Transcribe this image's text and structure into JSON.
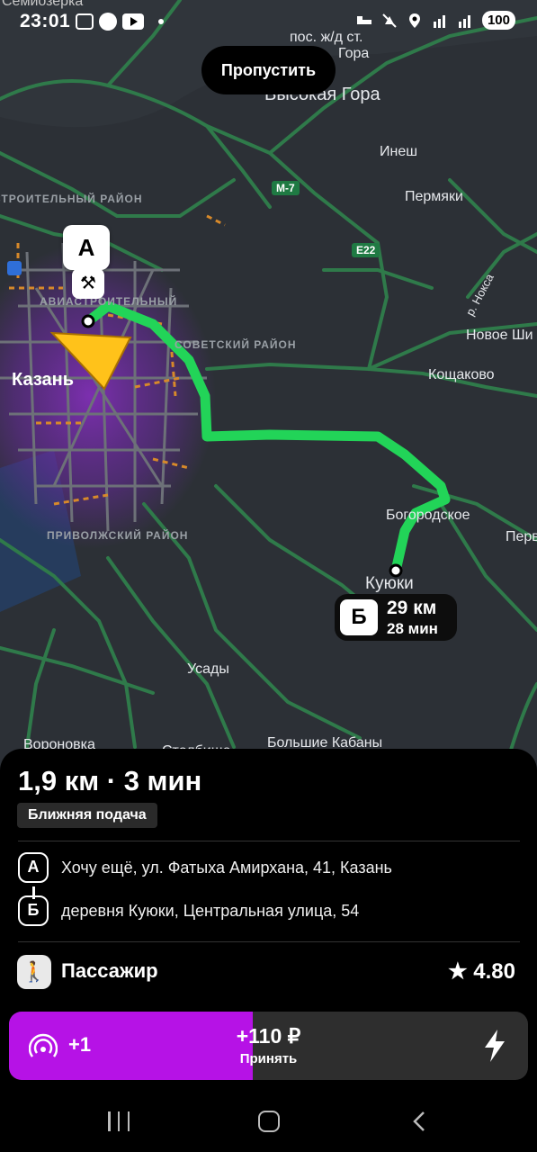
{
  "status_bar": {
    "time": "23:01",
    "battery": "100"
  },
  "map": {
    "skip_button": "Пропустить",
    "labels": {
      "semiozerka": "Семиозерка",
      "pos_zhd_st": "пос. ж/д ст.",
      "gora": "Гора",
      "vysokaya_gora": "Высокая Гора",
      "inesh": "Инеш",
      "permyaki": "Пермяки",
      "kazan": "Казань",
      "novoe_shi": "Новое Ши",
      "koshchakovo": "Кощаково",
      "bogorodskoe": "Богородское",
      "perv": "Перв",
      "kuyuki": "Куюки",
      "usady": "Усады",
      "voronovka": "Вороновка",
      "stolbishche": "Столбище",
      "bolshie_kabany": "Большие Кабаны",
      "r_noksa": "р. Нокса",
      "district_stroitelny": "СТРОИТЕЛЬНЫЙ РАЙОН",
      "district_aviastroitelny": "АВИАСТРОИТЕЛЬНЫЙ",
      "district_sovetsky": "СОВЕТСКИЙ РАЙОН",
      "district_privolzhsky": "ПРИВОЛЖСКИЙ РАЙОН"
    },
    "road_badges": {
      "m7": "М-7",
      "e22": "E22"
    },
    "marker_a": "А",
    "destination": {
      "letter": "Б",
      "distance": "29 км",
      "duration": "28 мин"
    },
    "colors": {
      "route": "#22d458",
      "roads": "#2f7a4a",
      "background": "#2c3036",
      "heat": "#8a2fc4"
    }
  },
  "order": {
    "eta": "1,9 км · 3 мин",
    "badge": "Ближняя подача",
    "pickup": {
      "letter": "А",
      "address": "Хочу ещё, ул. Фатыха Амирхана, 41, Казань"
    },
    "dropoff": {
      "letter": "Б",
      "address": "деревня Куюки, Центральная улица, 54"
    },
    "passenger": {
      "label": "Пассажир",
      "rating": "★ 4.80",
      "icon": "person-walking-icon"
    },
    "accept": {
      "multiplier": "+1",
      "price": "+110 ₽",
      "label": "Принять",
      "progress": 0.47,
      "fill_color": "#b612e6",
      "icons": [
        "radio-waves-icon",
        "lightning-bolt-icon"
      ]
    }
  },
  "nav_bar": {
    "icons": [
      "recents-icon",
      "home-icon",
      "back-icon"
    ]
  }
}
